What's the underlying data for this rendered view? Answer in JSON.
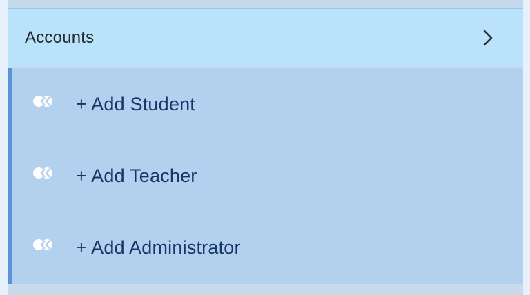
{
  "accounts": {
    "title": "Accounts",
    "chevron_icon": "chevron-right-icon"
  },
  "submenu": {
    "items": [
      {
        "label": "+ Add Student",
        "icon": "user-badge-icon"
      },
      {
        "label": "+ Add Teacher",
        "icon": "user-badge-icon"
      },
      {
        "label": "+ Add Administrator",
        "icon": "user-badge-icon"
      }
    ]
  },
  "colors": {
    "header_bg": "#bae3fb",
    "submenu_bg": "#b3d1ee",
    "accent_bar": "#5b93dd",
    "label_text": "#143768"
  }
}
